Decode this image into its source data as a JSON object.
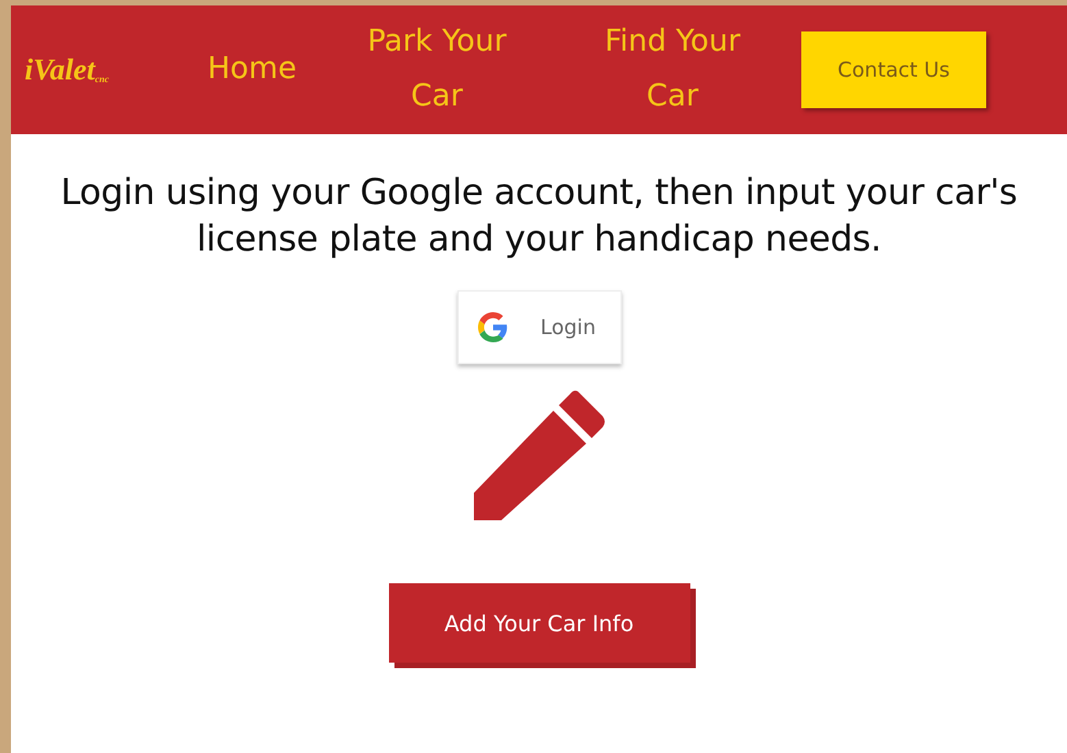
{
  "logo": {
    "name": "iValet",
    "suffix": "cnc"
  },
  "nav": [
    {
      "label": "Home",
      "kind": "link"
    },
    {
      "label": "Park Your Car",
      "kind": "link"
    },
    {
      "label": "Find Your Car",
      "kind": "link"
    },
    {
      "label": "Contact Us",
      "kind": "button"
    }
  ],
  "heading": "Login using your Google account, then input your car's license plate and your handicap needs.",
  "login_button": "Login",
  "add_button": "Add Your Car Info"
}
